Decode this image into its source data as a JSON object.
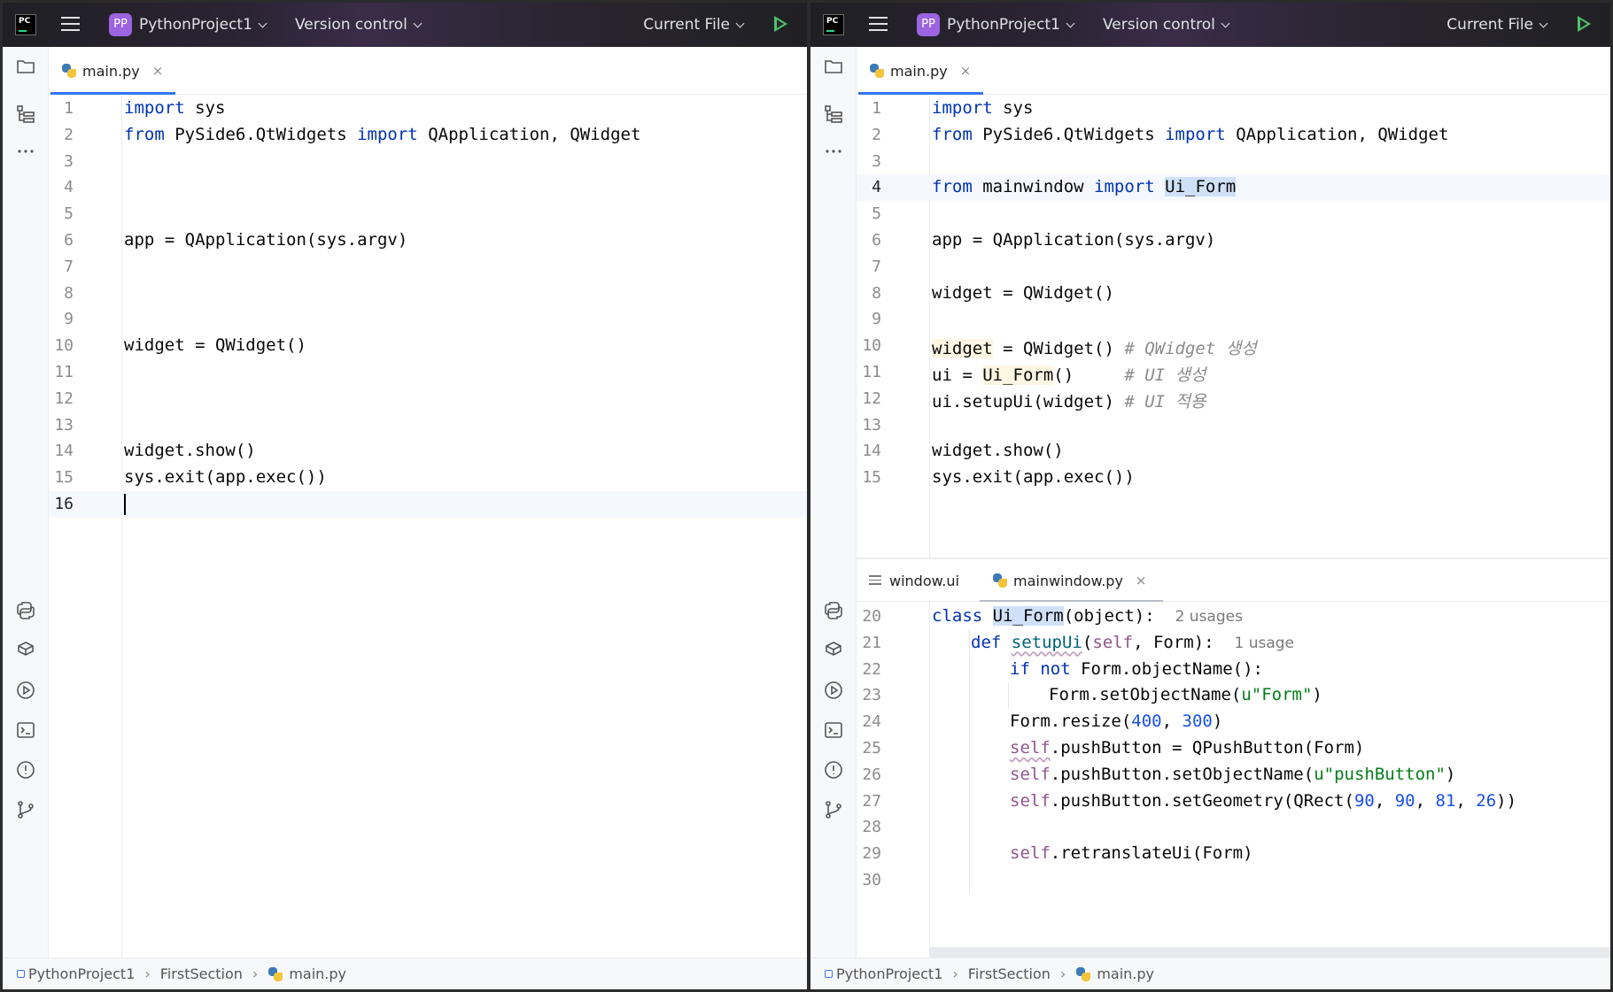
{
  "titlebar": {
    "logo_text": "PC",
    "project_badge": "PP",
    "project_name": "PythonProject1",
    "version_control": "Version control",
    "run_config": "Current File"
  },
  "left": {
    "tab": {
      "label": "main.py",
      "close": "×"
    },
    "lines": [
      {
        "n": "1",
        "html": "<span class=\"kw\">import</span> sys"
      },
      {
        "n": "2",
        "html": "<span class=\"kw\">from</span> PySide6.QtWidgets <span class=\"kw\">import</span> QApplication, QWidget"
      },
      {
        "n": "3",
        "html": ""
      },
      {
        "n": "4",
        "html": ""
      },
      {
        "n": "5",
        "html": ""
      },
      {
        "n": "6",
        "html": "app = QApplication(sys.argv)"
      },
      {
        "n": "7",
        "html": ""
      },
      {
        "n": "8",
        "html": ""
      },
      {
        "n": "9",
        "html": ""
      },
      {
        "n": "10",
        "html": "widget = QWidget()"
      },
      {
        "n": "11",
        "html": ""
      },
      {
        "n": "12",
        "html": ""
      },
      {
        "n": "13",
        "html": ""
      },
      {
        "n": "14",
        "html": "widget.show()"
      },
      {
        "n": "15",
        "html": "sys.exit(app.exec())"
      },
      {
        "n": "16",
        "html": "<span class=\"caret\"></span>",
        "current": true
      }
    ],
    "breadcrumb": [
      "PythonProject1",
      "FirstSection",
      "main.py"
    ]
  },
  "right": {
    "tab": {
      "label": "main.py",
      "close": "×"
    },
    "lines": [
      {
        "n": "1",
        "html": "<span class=\"kw\">import</span> sys"
      },
      {
        "n": "2",
        "html": "<span class=\"kw\">from</span> PySide6.QtWidgets <span class=\"kw\">import</span> QApplication, QWidget"
      },
      {
        "n": "3",
        "html": ""
      },
      {
        "n": "4",
        "html": "<span class=\"kw\">from</span> mainwindow <span class=\"kw\">import</span> <span class=\"sel\">Ui_Form</span>",
        "current": true
      },
      {
        "n": "5",
        "html": ""
      },
      {
        "n": "6",
        "html": "app = QApplication(sys.argv)"
      },
      {
        "n": "7",
        "html": ""
      },
      {
        "n": "8",
        "html": "widget = QWidget()"
      },
      {
        "n": "9",
        "html": ""
      },
      {
        "n": "10",
        "html": "<span class=\"warm\">widget</span> = QWidget() <span class=\"cm\"># QWidget 생성</span>"
      },
      {
        "n": "11",
        "html": "ui = <span class=\"warm\">Ui_Form</span>()     <span class=\"cm\"># UI 생성</span>"
      },
      {
        "n": "12",
        "html": "ui.setupUi(widget) <span class=\"cm\"># UI 적용</span>"
      },
      {
        "n": "13",
        "html": ""
      },
      {
        "n": "14",
        "html": "widget.show()"
      },
      {
        "n": "15",
        "html": "sys.exit(app.exec())"
      }
    ],
    "split_tabs": [
      {
        "label": "window.ui",
        "active": false
      },
      {
        "label": "mainwindow.py",
        "active": true,
        "close": "×"
      }
    ],
    "lower_lines": [
      {
        "n": "20",
        "html": "<span class=\"kw\">class</span> <span class=\"sel\">Ui_Form</span>(object):  <span class=\"hint\">2 usages</span>",
        "indent": 0
      },
      {
        "n": "21",
        "html": "<span class=\"kw\">def</span> <span class=\"fn squiggle\">setupUi</span>(<span class=\"self\">self</span>, Form):  <span class=\"hint\">1 usage</span>",
        "indent": 1
      },
      {
        "n": "22",
        "html": "<span class=\"kw\">if not</span> Form.objectName():",
        "indent": 2
      },
      {
        "n": "23",
        "html": "Form.setObjectName(<span class=\"str\">u\"Form\"</span>)",
        "indent": 3
      },
      {
        "n": "24",
        "html": "Form.resize(<span class=\"num\">400</span>, <span class=\"num\">300</span>)",
        "indent": 2
      },
      {
        "n": "25",
        "html": "<span class=\"self squiggle\">self</span>.pushButton = QPushButton(Form)",
        "indent": 2
      },
      {
        "n": "26",
        "html": "<span class=\"self\">self</span>.pushButton.setObjectName(<span class=\"str\">u\"pushButton\"</span>)",
        "indent": 2
      },
      {
        "n": "27",
        "html": "<span class=\"self\">self</span>.pushButton.setGeometry(QRect(<span class=\"num\">90</span>, <span class=\"num\">90</span>, <span class=\"num\">81</span>, <span class=\"num\">26</span>))",
        "indent": 2
      },
      {
        "n": "28",
        "html": "",
        "indent": 2
      },
      {
        "n": "29",
        "html": "<span class=\"self\">self</span>.retranslateUi(Form)",
        "indent": 2
      },
      {
        "n": "30",
        "html": "",
        "indent": 2
      }
    ],
    "breadcrumb": [
      "PythonProject1",
      "FirstSection",
      "main.py"
    ]
  },
  "icons": {
    "project": "folder-icon",
    "structure": "structure-icon",
    "more": "more-icon",
    "python_packages": "python-packages-icon",
    "python_console": "python-console-icon",
    "services": "services-icon",
    "terminal": "terminal-icon",
    "problems": "problems-icon",
    "git": "git-icon"
  },
  "colors": {
    "accent": "#3574f0",
    "run": "#4ec36a",
    "keyword": "#0033b3",
    "project_badge": "#9c64e0"
  }
}
